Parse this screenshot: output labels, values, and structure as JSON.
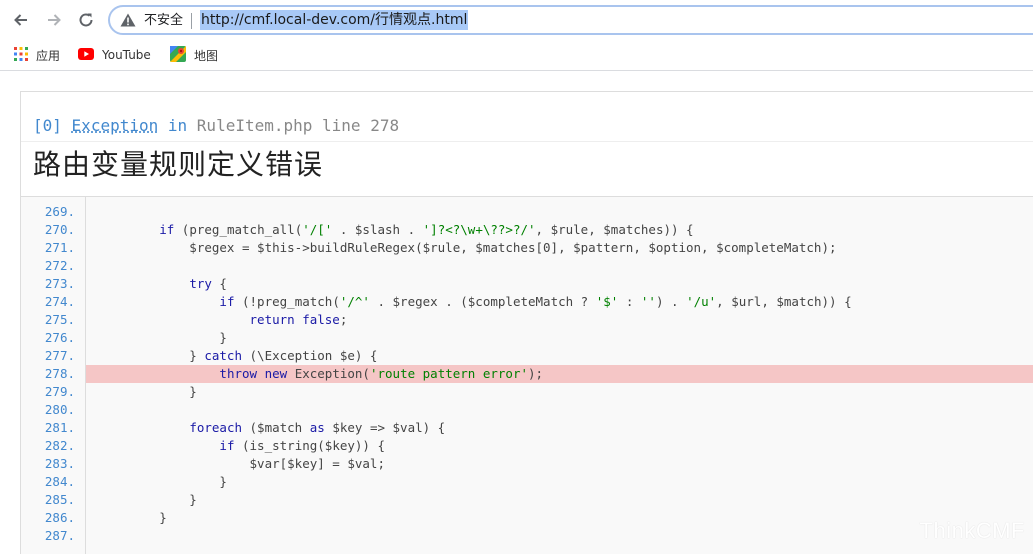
{
  "browser": {
    "security_label": "不安全",
    "url": "http://cmf.local-dev.com/行情观点.html",
    "bookmarks": [
      {
        "label": "应用",
        "icon": "apps-grid-icon"
      },
      {
        "label": "YouTube",
        "icon": "youtube-icon"
      },
      {
        "label": "地图",
        "icon": "maps-icon"
      }
    ]
  },
  "exception": {
    "index": "[0]",
    "class": "Exception",
    "in_word": "in",
    "file": "RuleItem.php",
    "line_word": "line",
    "line_no": "278",
    "message": "路由变量规则定义错误"
  },
  "source": {
    "highlight_line": "278.",
    "lines": [
      {
        "no": "269.",
        "code": ""
      },
      {
        "no": "270.",
        "code": "        if (preg_match_all('/[' . $slash . ']?<?\\w+\\??>?/', $rule, $matches)) {"
      },
      {
        "no": "271.",
        "code": "            $regex = $this->buildRuleRegex($rule, $matches[0], $pattern, $option, $completeMatch);"
      },
      {
        "no": "272.",
        "code": ""
      },
      {
        "no": "273.",
        "code": "            try {"
      },
      {
        "no": "274.",
        "code": "                if (!preg_match('/^' . $regex . ($completeMatch ? '$' : '') . '/u', $url, $match)) {"
      },
      {
        "no": "275.",
        "code": "                    return false;"
      },
      {
        "no": "276.",
        "code": "                }"
      },
      {
        "no": "277.",
        "code": "            } catch (\\Exception $e) {"
      },
      {
        "no": "278.",
        "code": "                throw new Exception('route pattern error');"
      },
      {
        "no": "279.",
        "code": "            }"
      },
      {
        "no": "280.",
        "code": ""
      },
      {
        "no": "281.",
        "code": "            foreach ($match as $key => $val) {"
      },
      {
        "no": "282.",
        "code": "                if (is_string($key)) {"
      },
      {
        "no": "283.",
        "code": "                    $var[$key] = $val;"
      },
      {
        "no": "284.",
        "code": "                }"
      },
      {
        "no": "285.",
        "code": "            }"
      },
      {
        "no": "286.",
        "code": "        }"
      },
      {
        "no": "287.",
        "code": ""
      }
    ]
  },
  "watermark": "ThinkCMF",
  "colors": {
    "highlight": "#f5c6c6",
    "line_number": "#4288ce",
    "url_selection": "#a8c9f7"
  }
}
